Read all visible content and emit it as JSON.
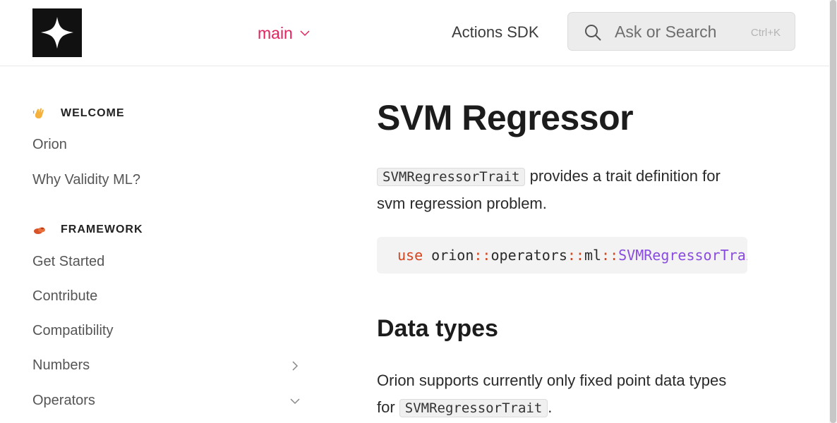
{
  "header": {
    "branch_label": "main",
    "nav_link": "Actions SDK",
    "search": {
      "placeholder": "Ask or Search",
      "shortcut": "Ctrl+K"
    }
  },
  "sidebar": {
    "sections": [
      {
        "title": "WELCOME",
        "icon": "waving-hand-icon",
        "items": [
          {
            "label": "Orion"
          },
          {
            "label": "Why Validity ML?"
          }
        ]
      },
      {
        "title": "FRAMEWORK",
        "icon": "framework-emoji-icon",
        "items": [
          {
            "label": "Get Started"
          },
          {
            "label": "Contribute"
          },
          {
            "label": "Compatibility"
          },
          {
            "label": "Numbers",
            "expandable": "collapsed"
          },
          {
            "label": "Operators",
            "expandable": "expanded"
          }
        ]
      }
    ]
  },
  "content": {
    "title": "SVM Regressor",
    "intro": {
      "code": "SVMRegressorTrait",
      "text": " provides a trait definition for svm regression problem."
    },
    "codeblock": {
      "kw": "use",
      "p1": "orion",
      "sep1": "::",
      "p2": "operators",
      "sep2": "::",
      "p3": "ml",
      "sep3": "::",
      "p4": "SVMRegressorTrait;"
    },
    "h2": "Data types",
    "datatypes": {
      "text_before": "Orion supports currently only fixed point data types for ",
      "code": "SVMRegressorTrait",
      "text_after": "."
    }
  },
  "colors": {
    "accent": "#e0245e",
    "keyword": "#d6451e",
    "type": "#8a4be0"
  }
}
